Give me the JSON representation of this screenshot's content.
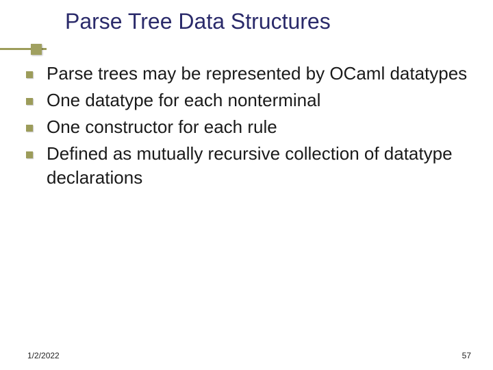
{
  "title": "Parse Tree Data Structures",
  "bullets": [
    "Parse trees may be represented by OCaml datatypes",
    "One datatype for each nonterminal",
    "One constructor for each rule",
    "Defined as mutually recursive collection of datatype declarations"
  ],
  "footer": {
    "date": "1/2/2022",
    "page": "57"
  }
}
